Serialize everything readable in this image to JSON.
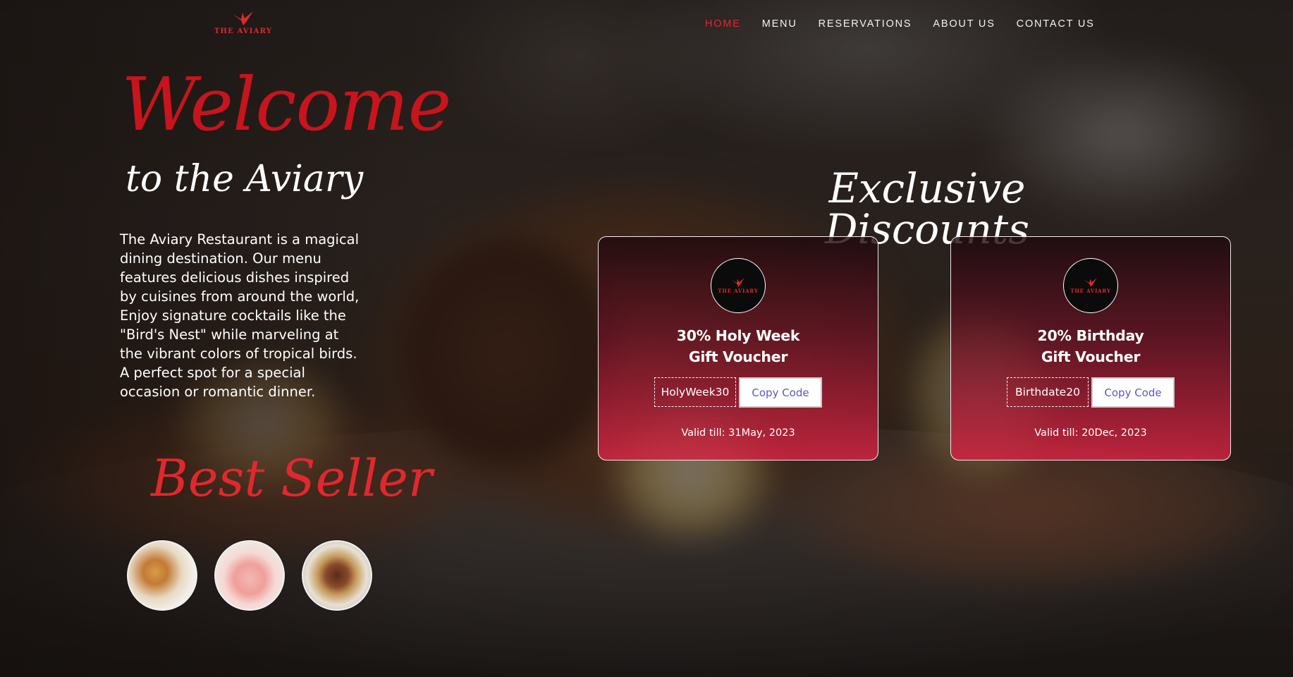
{
  "brand": {
    "logo_text": "THE AVIARY",
    "logo_icon": "bird-icon",
    "accent_color": "#e0282e"
  },
  "nav": {
    "items": [
      {
        "label": "HOME",
        "active": true
      },
      {
        "label": "MENU",
        "active": false
      },
      {
        "label": "RESERVATIONS",
        "active": false
      },
      {
        "label": "ABOUT US",
        "active": false
      },
      {
        "label": "CONTACT US",
        "active": false
      }
    ]
  },
  "hero": {
    "welcome": "Welcome",
    "subtitle": "to the Aviary",
    "description": "The Aviary Restaurant is a magical dining destination. Our menu features delicious dishes inspired by cuisines from around the world, Enjoy signature cocktails like the \"Bird's Nest\" while marveling at the vibrant colors of tropical birds. A perfect spot for a special occasion or romantic dinner."
  },
  "best_seller": {
    "title": "Best Seller",
    "items": [
      {
        "icon": "pastry-dish-icon"
      },
      {
        "icon": "pink-cocktail-icon"
      },
      {
        "icon": "stir-fry-bowl-icon"
      }
    ]
  },
  "discounts": {
    "title": "Exclusive Discounts",
    "vouchers": [
      {
        "logo_text": "THE AVIARY",
        "title_line1": "30% Holy Week",
        "title_line2": "Gift Voucher",
        "code": "HolyWeek30",
        "copy_label": "Copy Code",
        "valid": "Valid till: 31May, 2023"
      },
      {
        "logo_text": "THE AVIARY",
        "title_line1": "20% Birthday",
        "title_line2": "Gift Voucher",
        "code": "Birthdate20",
        "copy_label": "Copy Code",
        "valid": "Valid till: 20Dec, 2023"
      }
    ]
  }
}
